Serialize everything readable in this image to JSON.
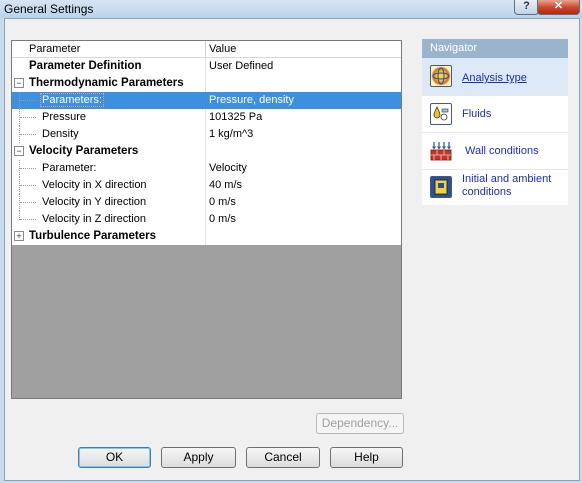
{
  "window": {
    "title": "General Settings",
    "help_glyph": "?",
    "close_glyph": "✕"
  },
  "grid": {
    "headers": {
      "parameter": "Parameter",
      "value": "Value"
    },
    "rows": [
      {
        "param": "Parameter Definition",
        "value": "User Defined",
        "bold": true
      },
      {
        "param": "Thermodynamic Parameters",
        "value": "",
        "bold": true,
        "expander": "−"
      },
      {
        "param": "Parameters:",
        "value": "Pressure, density",
        "selected": true
      },
      {
        "param": "Pressure",
        "value": "101325 Pa"
      },
      {
        "param": "Density",
        "value": "1 kg/m^3"
      },
      {
        "param": "Velocity Parameters",
        "value": "",
        "bold": true,
        "expander": "−"
      },
      {
        "param": "Parameter:",
        "value": "Velocity"
      },
      {
        "param": "Velocity in X direction",
        "value": "40 m/s"
      },
      {
        "param": "Velocity in Y direction",
        "value": "0 m/s"
      },
      {
        "param": "Velocity in Z direction",
        "value": "0 m/s"
      },
      {
        "param": "Turbulence Parameters",
        "value": "",
        "bold": true,
        "expander": "+"
      }
    ]
  },
  "navigator": {
    "title": "Navigator",
    "items": [
      {
        "label": "Analysis type",
        "icon": "analysis-type-icon",
        "active": true
      },
      {
        "label": "Fluids",
        "icon": "fluids-icon"
      },
      {
        "label": "Wall conditions",
        "icon": "wall-conditions-icon"
      },
      {
        "label": "Initial and ambient conditions",
        "icon": "initial-conditions-icon"
      }
    ]
  },
  "buttons": {
    "dependency": "Dependency...",
    "ok": "OK",
    "apply": "Apply",
    "cancel": "Cancel",
    "help": "Help"
  }
}
